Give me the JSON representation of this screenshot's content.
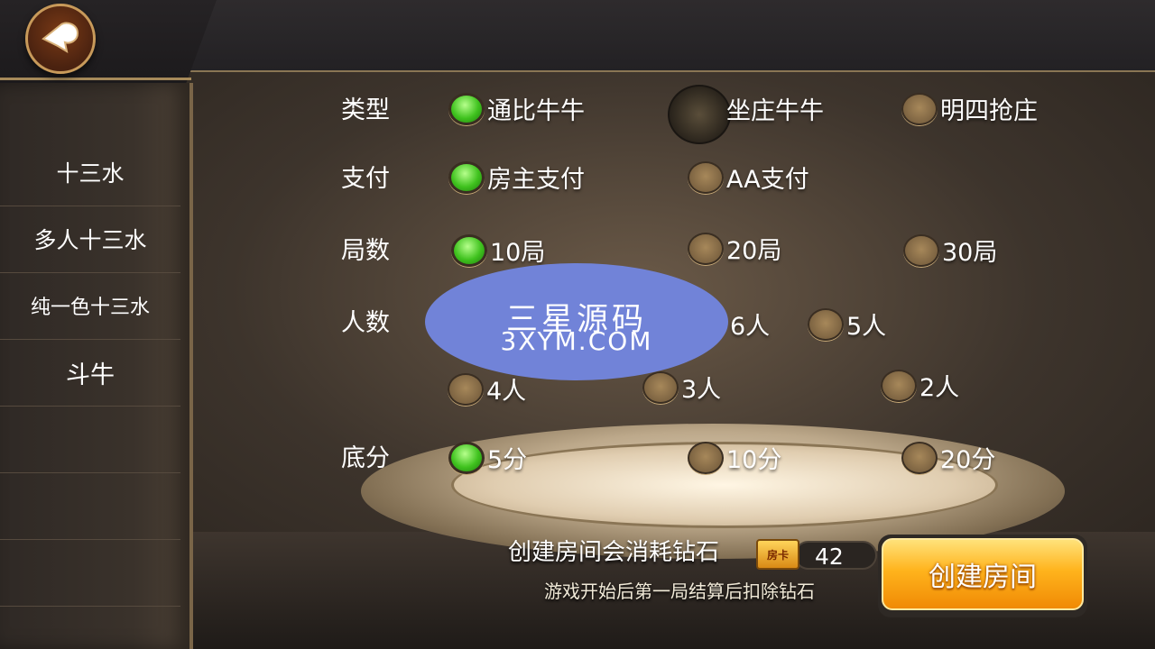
{
  "header": {
    "back_icon": "spade-back-icon"
  },
  "sidebar": {
    "items": [
      {
        "label": "十三水"
      },
      {
        "label": "多人十三水"
      },
      {
        "label": "纯一色十三水"
      },
      {
        "label": "斗牛"
      }
    ]
  },
  "form": {
    "type": {
      "label": "类型",
      "options": [
        {
          "label": "通比牛牛",
          "selected": true
        },
        {
          "label": "坐庄牛牛",
          "selected": false
        },
        {
          "label": "明四抢庄",
          "selected": false
        }
      ]
    },
    "payment": {
      "label": "支付",
      "options": [
        {
          "label": "房主支付",
          "selected": true
        },
        {
          "label": "AA支付",
          "selected": false
        }
      ]
    },
    "rounds": {
      "label": "局数",
      "options": [
        {
          "label": "10局",
          "selected": true
        },
        {
          "label": "20局",
          "selected": false
        },
        {
          "label": "30局",
          "selected": false
        }
      ]
    },
    "players": {
      "label": "人数",
      "options": [
        {
          "label": "6人",
          "selected": false
        },
        {
          "label": "5人",
          "selected": false
        },
        {
          "label": "4人",
          "selected": false
        },
        {
          "label": "3人",
          "selected": false
        },
        {
          "label": "2人",
          "selected": false
        }
      ]
    },
    "base_score": {
      "label": "底分",
      "options": [
        {
          "label": "5分",
          "selected": true
        },
        {
          "label": "10分",
          "selected": false
        },
        {
          "label": "20分",
          "selected": false
        }
      ]
    }
  },
  "watermark": {
    "line1": "三星源码",
    "line2": "3XYM.COM"
  },
  "footer": {
    "cost_text": "创建房间会消耗钻石",
    "card_badge": "房卡",
    "card_count": "42",
    "note": "游戏开始后第一局结算后扣除钻石",
    "create_button": "创建房间"
  },
  "colors": {
    "selected_radio": "#3fc21e",
    "button": "#ffb31c",
    "accent_gold": "#a68a5a"
  }
}
